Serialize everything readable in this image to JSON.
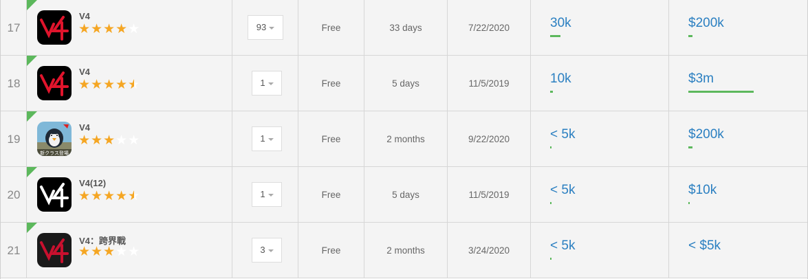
{
  "rows": [
    {
      "rank": "17",
      "name": "V4",
      "rating": 4,
      "icon": "v4-red-icon",
      "version": "93",
      "price": "Free",
      "age": "33 days",
      "date": "7/22/2020",
      "downloads": "30k",
      "downloads_level": 0.08,
      "revenue": "$200k",
      "revenue_level": 0.03
    },
    {
      "rank": "18",
      "name": "V4",
      "rating": 4.5,
      "icon": "v4-red-icon",
      "version": "1",
      "price": "Free",
      "age": "5 days",
      "date": "11/5/2019",
      "downloads": "10k",
      "downloads_level": 0.02,
      "revenue": "$3m",
      "revenue_level": 0.5
    },
    {
      "rank": "19",
      "name": "V4",
      "rating": 3,
      "icon": "penguin-icon",
      "icon_text": "新クラス登場",
      "version": "1",
      "price": "Free",
      "age": "2 months",
      "date": "9/22/2020",
      "downloads": "< 5k",
      "downloads_level": 0.005,
      "revenue": "$200k",
      "revenue_level": 0.03
    },
    {
      "rank": "20",
      "name": "V4(12)",
      "rating": 4.5,
      "icon": "v4-white-icon",
      "version": "1",
      "price": "Free",
      "age": "5 days",
      "date": "11/5/2019",
      "downloads": "< 5k",
      "downloads_level": 0.005,
      "revenue": "$10k",
      "revenue_level": 0.005
    },
    {
      "rank": "21",
      "name": "V4：跨界戰",
      "rating": 3,
      "icon": "v4-dark-red-icon",
      "version": "3",
      "price": "Free",
      "age": "2 months",
      "date": "3/24/2020",
      "downloads": "< 5k",
      "downloads_level": 0.005,
      "revenue": "< $5k",
      "revenue_level": 0
    }
  ],
  "colors": {
    "accent_blue": "#2a7fc1",
    "bar_green": "#5cb85c",
    "star_gold": "#f5a623"
  }
}
